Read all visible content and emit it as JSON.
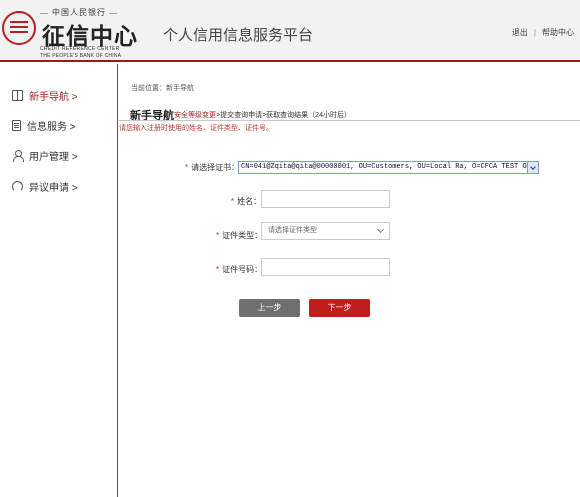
{
  "header": {
    "logo_top": "— 中国人民银行 —",
    "logo_main": "征信中心",
    "logo_en_1": "CREDIT REFERENCE CENTER",
    "logo_en_2": "THE PEOPLE'S BANK OF CHINA",
    "platform_title": "个人信用信息服务平台",
    "logout_label": "退出",
    "separator": "|",
    "help_label": "帮助中心"
  },
  "sidebar": {
    "items": [
      {
        "label": "新手导航 >",
        "icon": "book-icon"
      },
      {
        "label": "信息服务 >",
        "icon": "document-icon"
      },
      {
        "label": "用户管理 >",
        "icon": "user-icon"
      },
      {
        "label": "异议申请 >",
        "icon": "headset-icon"
      }
    ]
  },
  "main": {
    "breadcrumb": "当前位置：新手导航",
    "section_title": "新手导航",
    "steps": {
      "step1": "安全等级变更",
      "rest": ">提交查询申请>获取查询结果（24小时后）"
    },
    "notice": "请您输入注册时使用的姓名、证件类型、证件号。",
    "form": {
      "cert_label": "请选择证书：",
      "cert_value": "CN=041@Zqita@qita@00000001, OU=Customers, OU=Local Ra, O=CFCA TEST OCA1, C=cn",
      "name_label": "姓名：",
      "name_value": "",
      "id_type_label": "证件类型：",
      "id_type_placeholder": "请选择证件类型",
      "id_number_label": "证件号码：",
      "id_number_value": "",
      "required_mark": "*"
    },
    "buttons": {
      "prev": "上一步",
      "next": "下一步"
    }
  },
  "colors": {
    "brand_red": "#a31e1e",
    "next_button": "#c01d1d",
    "prev_button": "#6f6f6f",
    "notice_red": "#c0392b"
  }
}
